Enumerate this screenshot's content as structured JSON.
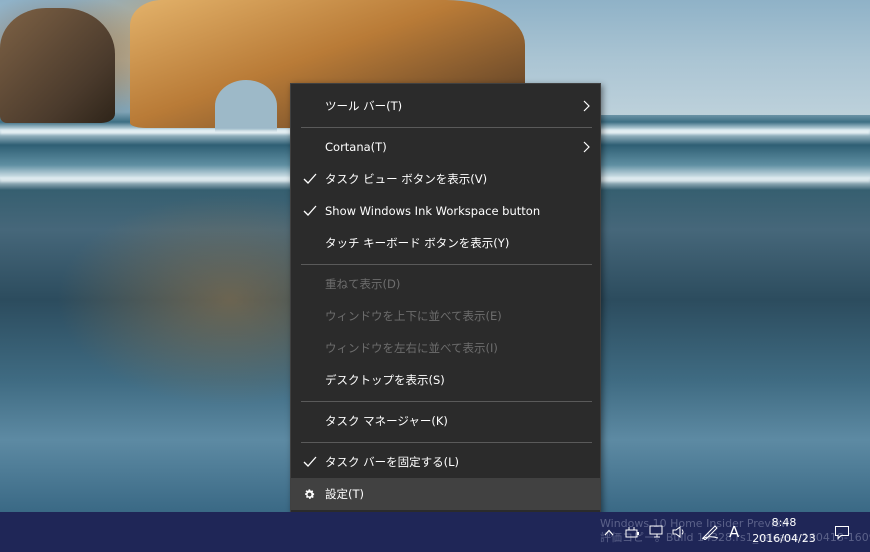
{
  "context_menu": {
    "items": [
      {
        "label": "ツール バー(T)",
        "checked": false,
        "submenu": true,
        "disabled": false
      },
      {
        "label": "Cortana(T)",
        "checked": false,
        "submenu": true,
        "disabled": false
      },
      {
        "label": "タスク ビュー ボタンを表示(V)",
        "checked": true,
        "submenu": false,
        "disabled": false
      },
      {
        "label": "Show Windows Ink Workspace button",
        "checked": true,
        "submenu": false,
        "disabled": false
      },
      {
        "label": "タッチ キーボード ボタンを表示(Y)",
        "checked": false,
        "submenu": false,
        "disabled": false
      },
      {
        "label": "重ねて表示(D)",
        "checked": false,
        "submenu": false,
        "disabled": true
      },
      {
        "label": "ウィンドウを上下に並べて表示(E)",
        "checked": false,
        "submenu": false,
        "disabled": true
      },
      {
        "label": "ウィンドウを左右に並べて表示(I)",
        "checked": false,
        "submenu": false,
        "disabled": true
      },
      {
        "label": "デスクトップを表示(S)",
        "checked": false,
        "submenu": false,
        "disabled": false
      },
      {
        "label": "タスク マネージャー(K)",
        "checked": false,
        "submenu": false,
        "disabled": false
      },
      {
        "label": "タスク バーを固定する(L)",
        "checked": true,
        "submenu": false,
        "disabled": false
      },
      {
        "label": "設定(T)",
        "checked": false,
        "submenu": false,
        "disabled": false,
        "highlighted": true,
        "icon": "gear-icon"
      }
    ]
  },
  "taskbar": {
    "watermark_line1": "Windows 10 Home Insider Preview",
    "watermark_line2": "評価コピー。Build 14328.rs1_release.160418-1609",
    "ime_label": "A",
    "clock_time": "8:48",
    "clock_date": "2016/04/23",
    "tray_icons": [
      "chevron-up-icon",
      "battery-icon",
      "network-icon",
      "volume-icon",
      "pen-icon",
      "notification-icon"
    ]
  },
  "colors": {
    "menu_background": "#2b2b2b",
    "menu_highlight": "#414141",
    "menu_disabled_text": "#6d6d6d",
    "taskbar_background": "#1f2657"
  }
}
